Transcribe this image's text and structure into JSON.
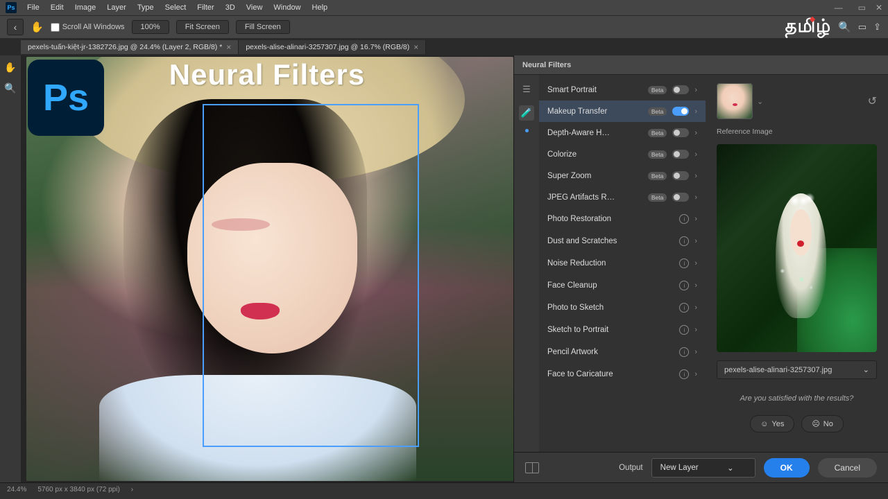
{
  "menubar": {
    "items": [
      "File",
      "Edit",
      "Image",
      "Layer",
      "Type",
      "Select",
      "Filter",
      "3D",
      "View",
      "Window",
      "Help"
    ]
  },
  "optbar": {
    "scroll_all": "Scroll All Windows",
    "zoom_pct": "100%",
    "fit_btn": "Fit Screen",
    "fill_btn": "Fill Screen",
    "brand_text": "தமிழ்"
  },
  "tabs": [
    {
      "label": "pexels-tuấn-kiệt-jr-1382726.jpg @ 24.4% (Layer 2, RGB/8) *",
      "active": true
    },
    {
      "label": "pexels-alise-alinari-3257307.jpg @ 16.7% (RGB/8)",
      "active": false
    }
  ],
  "canvas": {
    "title_overlay": "Neural Filters",
    "logo_text": "Ps"
  },
  "nf": {
    "panel_title": "Neural Filters",
    "filters": [
      {
        "name": "Smart Portrait",
        "badge": "Beta",
        "type": "toggle",
        "on": false
      },
      {
        "name": "Makeup Transfer",
        "badge": "Beta",
        "type": "toggle",
        "on": true,
        "active": true
      },
      {
        "name": "Depth-Aware H…",
        "badge": "Beta",
        "type": "toggle",
        "on": false
      },
      {
        "name": "Colorize",
        "badge": "Beta",
        "type": "toggle",
        "on": false
      },
      {
        "name": "Super Zoom",
        "badge": "Beta",
        "type": "toggle",
        "on": false
      },
      {
        "name": "JPEG Artifacts R…",
        "badge": "Beta",
        "type": "toggle",
        "on": false
      },
      {
        "name": "Photo Restoration",
        "type": "info"
      },
      {
        "name": "Dust and Scratches",
        "type": "info"
      },
      {
        "name": "Noise Reduction",
        "type": "info"
      },
      {
        "name": "Face Cleanup",
        "type": "info"
      },
      {
        "name": "Photo to Sketch",
        "type": "info"
      },
      {
        "name": "Sketch to Portrait",
        "type": "info"
      },
      {
        "name": "Pencil Artwork",
        "type": "info"
      },
      {
        "name": "Face to Caricature",
        "type": "info"
      }
    ],
    "ref_label": "Reference Image",
    "ref_file": "pexels-alise-alinari-3257307.jpg",
    "satisfied_q": "Are you satisfied with the results?",
    "yes": "Yes",
    "no": "No"
  },
  "bottom": {
    "output_label": "Output",
    "output_value": "New Layer",
    "ok": "OK",
    "cancel": "Cancel"
  },
  "status": {
    "zoom": "24.4%",
    "doc_info": "5760 px x 3840 px (72 ppi)"
  }
}
